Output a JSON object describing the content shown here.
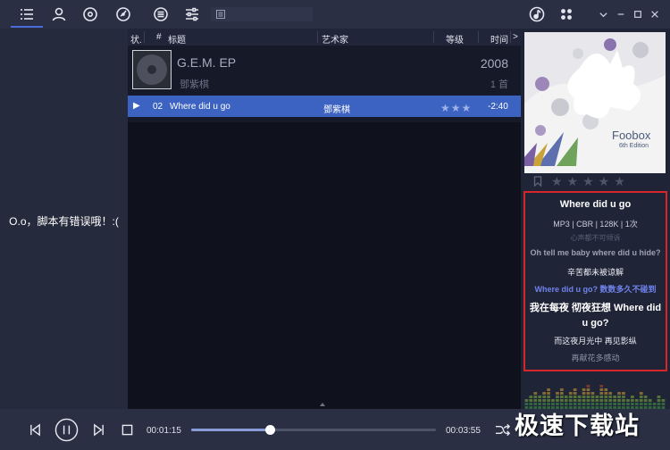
{
  "left_panel": {
    "message": "O.o，脚本有错误哦！:("
  },
  "playlist": {
    "columns": {
      "status": "状.",
      "num": "#",
      "title": "标题",
      "artist": "艺术家",
      "rating": "等级",
      "time": "时间",
      "more": ">"
    },
    "album": {
      "title": "G.E.M. EP",
      "artist": "鄧紫棋",
      "year": "2008",
      "count": "1 首"
    },
    "track": {
      "play": "▶",
      "num": "02",
      "title": "Where did u go",
      "artist": "鄧紫棋",
      "stars": "★★★",
      "time": "-2:40"
    }
  },
  "right_panel": {
    "cover": {
      "title": "Foobox",
      "edition": "6th Edition"
    },
    "rating": "★★★★★",
    "lyrics": {
      "title": "Where did u go",
      "info": "MP3 | CBR | 128K | 1次",
      "faded": "心声都不可倾诉",
      "line1": "Oh tell me baby where did u hide?",
      "line2": "辛苦都未被谅解",
      "current": "Where did u go? 数数多久不碰到",
      "line4": "我在每夜 彻夜狂想 Where did u go?",
      "line5": "而这夜月光中 再见影纵",
      "line6": "再献花多感动"
    },
    "spectrum": [
      14,
      18,
      22,
      16,
      20,
      24,
      12,
      19,
      23,
      17,
      21,
      25,
      15,
      26,
      30,
      22,
      18,
      27,
      24,
      20,
      16,
      22,
      19,
      14,
      18,
      12,
      20,
      17,
      13,
      10,
      15,
      12
    ]
  },
  "player": {
    "elapsed": "00:01:15",
    "total": "00:03:55",
    "progress": 0.32
  },
  "watermark": "极速下载站"
}
